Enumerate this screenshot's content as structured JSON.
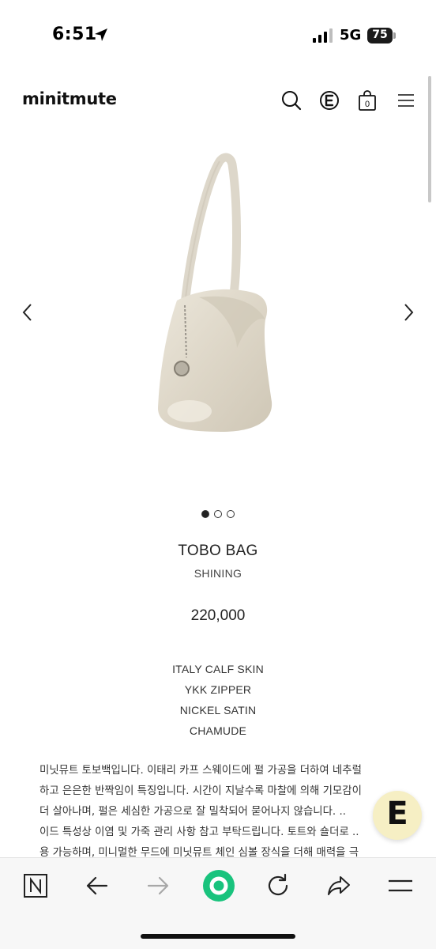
{
  "status_bar": {
    "time": "6:51",
    "network": "5G",
    "battery": "75"
  },
  "header": {
    "brand": "minitmute",
    "icons": [
      "search-icon",
      "e-logo-icon",
      "cart-icon",
      "menu-icon"
    ],
    "cart_count": "0"
  },
  "gallery": {
    "total_images": 3,
    "active_index": 0
  },
  "product": {
    "name": "TOBO BAG",
    "color": "SHINING",
    "price": "220,000",
    "specs": [
      "ITALY CALF SKIN",
      "YKK ZIPPER",
      "NICKEL SATIN",
      "CHAMUDE"
    ],
    "description_lines": [
      "미닛뮤트 토보백입니다. 이태리 카프 스웨이드에 펄 가공을 더하여 네추럴",
      "하고 은은한 반짝임이 특징입니다. 시간이 지날수록 마찰에 의해 기모감이",
      "더 살아나며, 펄은 세심한 가공으로 잘 밀착되어 묻어나지 않습니다. ..",
      "이드 특성상 이염 및 가죽 관리 사항 참고 부탁드립니다. 토트와 숄더로 ..",
      "용 가능하며, 미니멀한 무드에 미닛뮤트 체인 심볼 장식을 더해 매력을 극"
    ]
  },
  "floating_button": {
    "letter": "E"
  },
  "toolbar": {
    "icons": [
      "n-logo-icon",
      "back-arrow-icon",
      "forward-arrow-icon",
      "home-circle-icon",
      "refresh-icon",
      "share-icon",
      "menu-icon"
    ]
  },
  "colors": {
    "toolbar_home": "#19c37d",
    "fab_bg": "#f6efc4",
    "bag": "#e3ddd0"
  }
}
